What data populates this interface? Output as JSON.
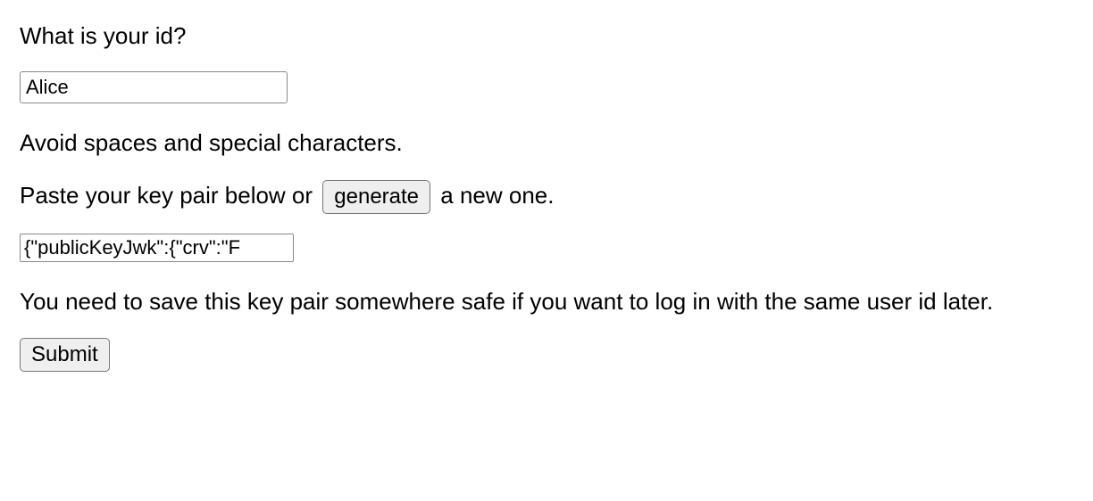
{
  "prompt_id": "What is your id?",
  "id_value": "Alice",
  "hint_id": "Avoid spaces and special characters.",
  "paste_prefix": "Paste your key pair below or ",
  "generate_label": "generate",
  "paste_suffix": " a new one.",
  "keypair_value": "{\"publicKeyJwk\":{\"crv\":\"F",
  "save_note": "You need to save this key pair somewhere safe if you want to log in with the same user id later.",
  "submit_label": "Submit"
}
